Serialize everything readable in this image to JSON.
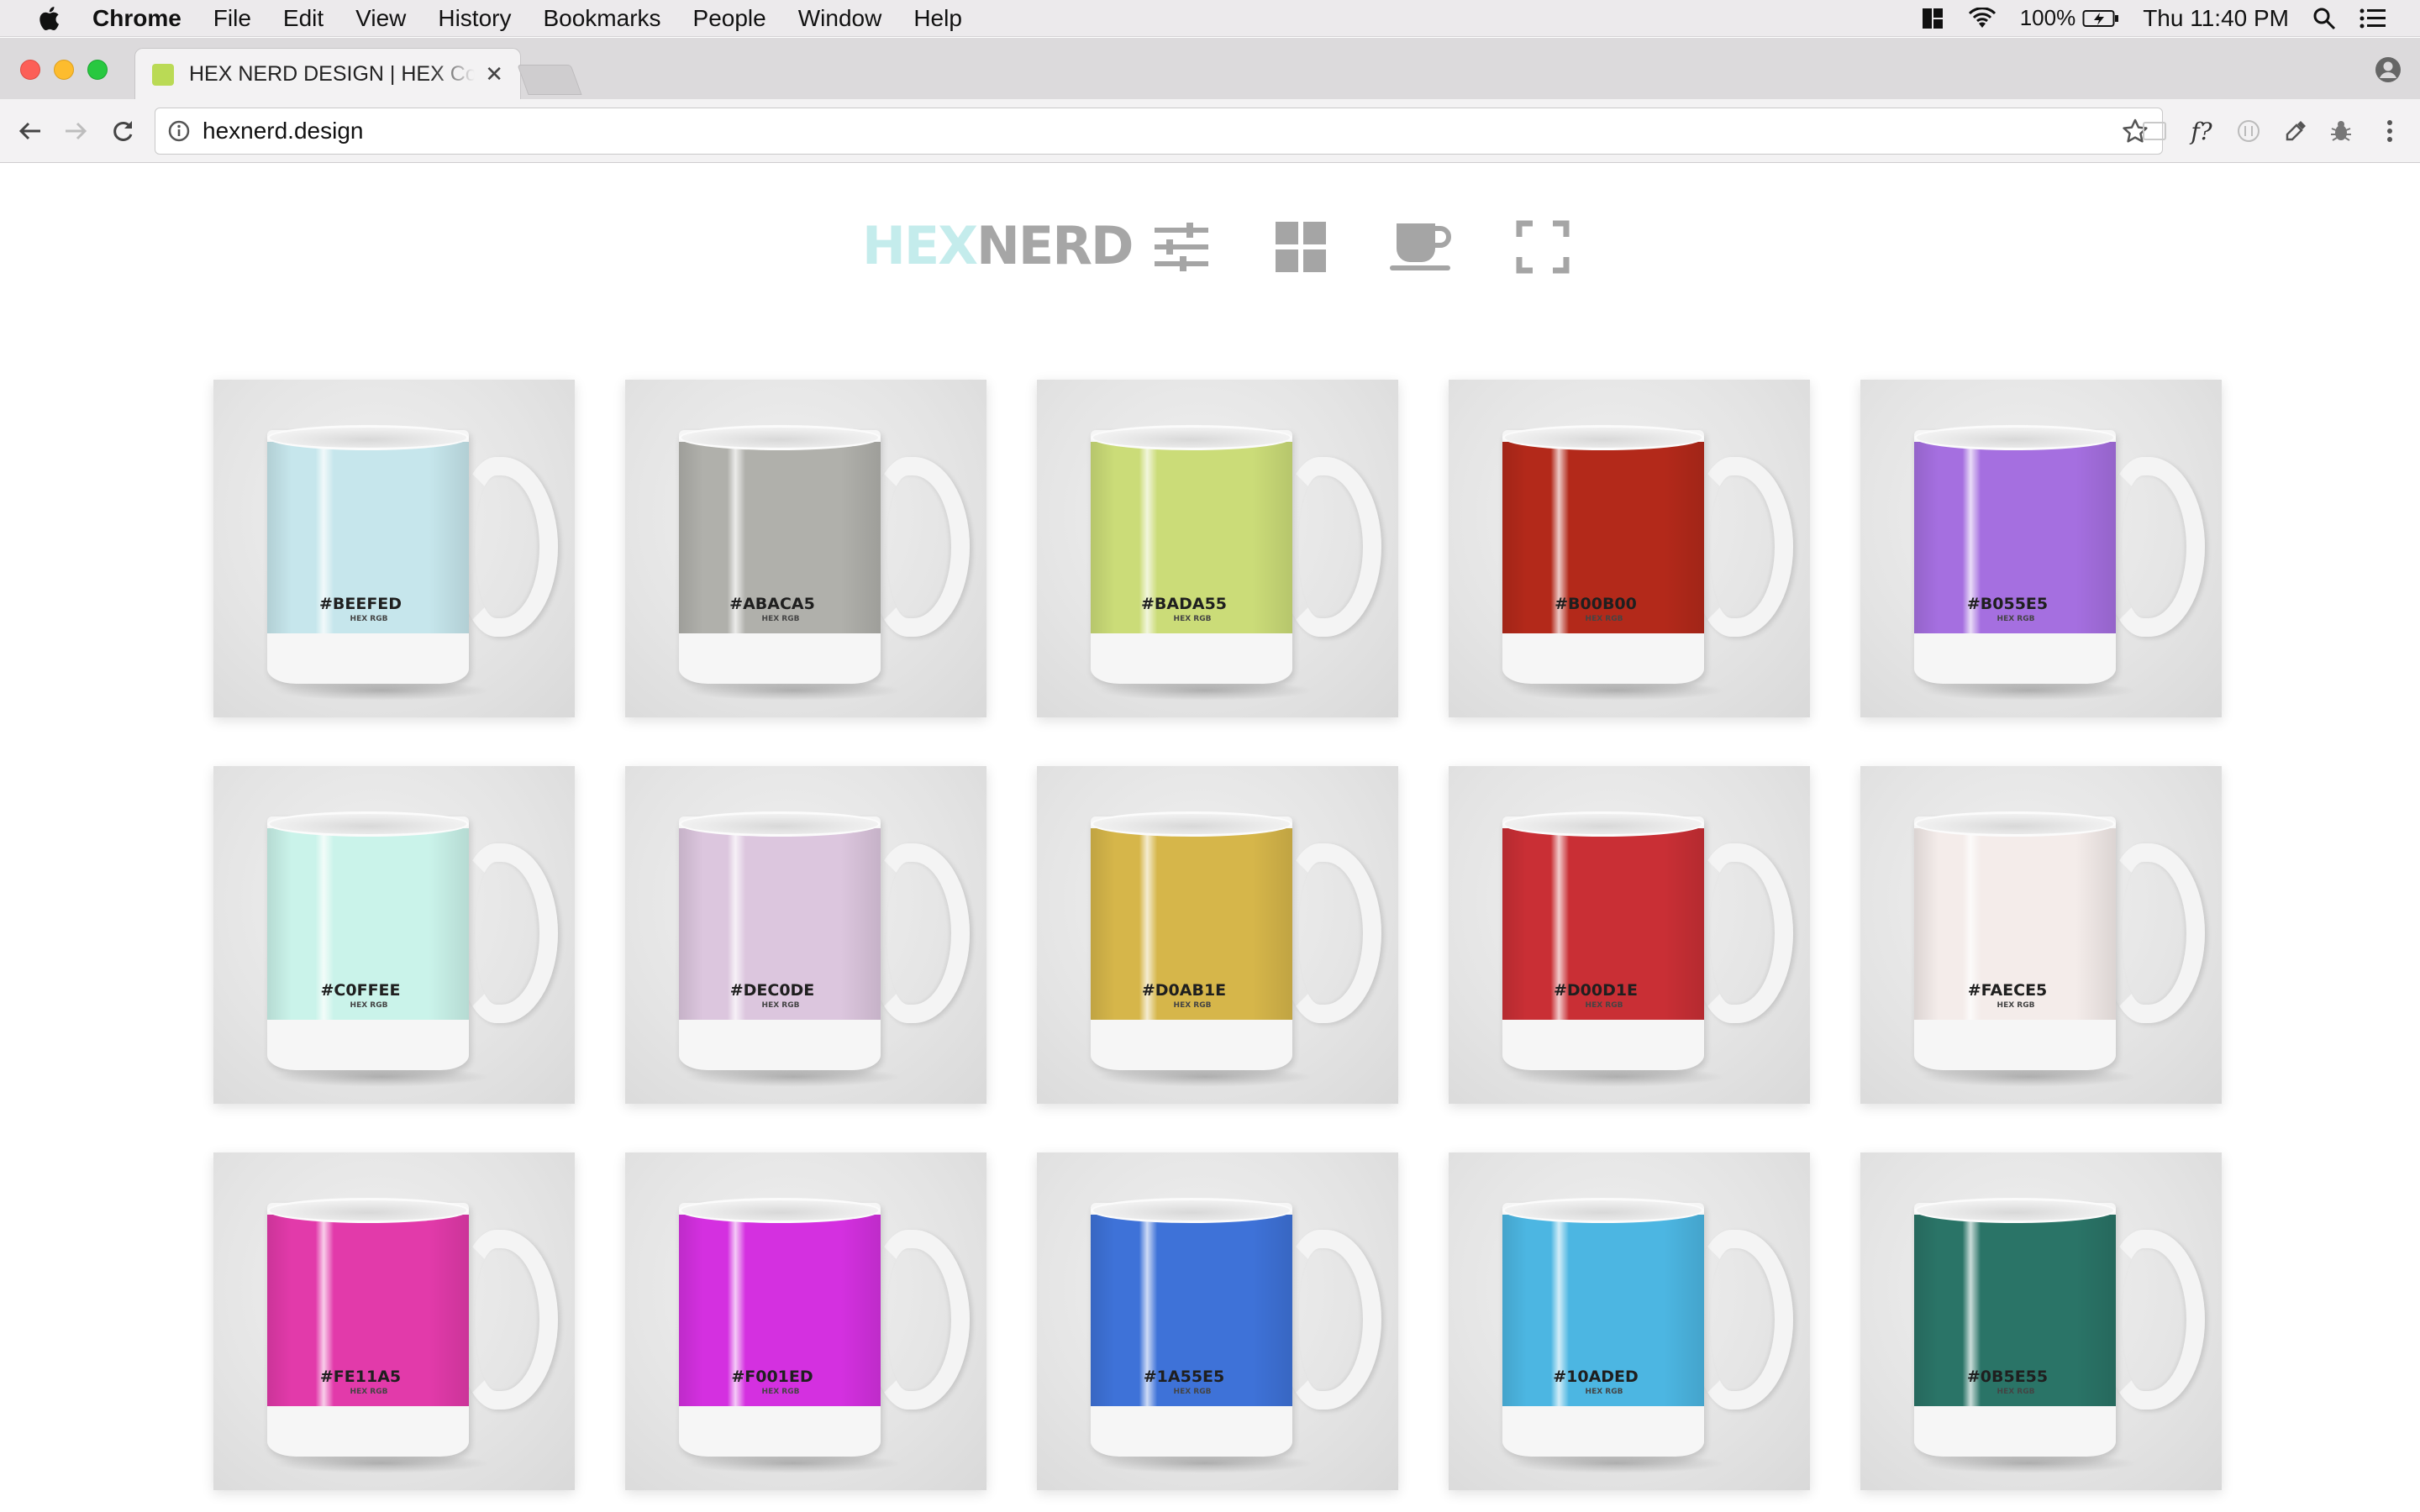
{
  "menubar": {
    "app_name": "Chrome",
    "items": [
      "File",
      "Edit",
      "View",
      "History",
      "Bookmarks",
      "People",
      "Window",
      "Help"
    ],
    "battery": "100%",
    "clock": "Thu 11:40 PM"
  },
  "tab": {
    "title": "HEX NERD DESIGN | HEX Color Mugs",
    "favicon_color": "#bada55"
  },
  "omnibox": {
    "url": "hexnerd.design"
  },
  "header": {
    "logo_hex": "HEX",
    "logo_nerd": "NERD",
    "icons": [
      "sliders-icon",
      "grid-icon",
      "mug-icon",
      "fullscreen-icon"
    ]
  },
  "mugs": [
    {
      "code": "#BEEFED",
      "sub": "HEX RGB",
      "color": "#c6e6ec"
    },
    {
      "code": "#ABACA5",
      "sub": "HEX RGB",
      "color": "#b0b0ab"
    },
    {
      "code": "#BADA55",
      "sub": "HEX RGB",
      "color": "#cbdc78"
    },
    {
      "code": "#B00B00",
      "sub": "HEX RGB",
      "color": "#b3291a"
    },
    {
      "code": "#B055E5",
      "sub": "HEX RGB",
      "color": "#a56fe0"
    },
    {
      "code": "#C0FFEE",
      "sub": "HEX RGB",
      "color": "#caf3ea"
    },
    {
      "code": "#DEC0DE",
      "sub": "HEX RGB",
      "color": "#dcc6de"
    },
    {
      "code": "#D0AB1E",
      "sub": "HEX RGB",
      "color": "#d6b64a"
    },
    {
      "code": "#D00D1E",
      "sub": "HEX RGB",
      "color": "#c92f35"
    },
    {
      "code": "#FAECE5",
      "sub": "HEX RGB",
      "color": "#f4ecea"
    },
    {
      "code": "#FE11A5",
      "sub": "HEX RGB",
      "color": "#e23aaa"
    },
    {
      "code": "#F001ED",
      "sub": "HEX RGB",
      "color": "#d430e0"
    },
    {
      "code": "#1A55E5",
      "sub": "HEX RGB",
      "color": "#3e72d8"
    },
    {
      "code": "#10ADED",
      "sub": "HEX RGB",
      "color": "#4cb6e2"
    },
    {
      "code": "#0B5E55",
      "sub": "HEX RGB",
      "color": "#2a7467"
    }
  ]
}
